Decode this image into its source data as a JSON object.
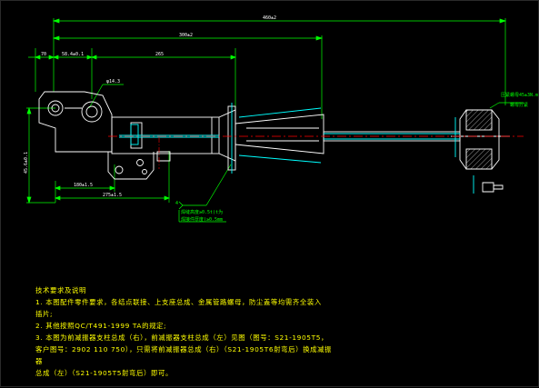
{
  "dimensions": {
    "overall_length": "460±2",
    "middle_length": "300±2",
    "top_offset_left": "70",
    "top_offset_mid": "58.4±0.1",
    "top_offset_right": "265",
    "diameter_label": "φ14.3",
    "height_label": "45.6±0.1",
    "bottom_dim_1": "180±1.5",
    "bottom_dim_2": "275±1.5"
  },
  "annotations": {
    "right_callout_line1": "压紧螺母45±3N.m",
    "right_callout_line2": "螺母拧紧",
    "weld_symbol": "4",
    "weld_note_1": "焊缝高度≥0.5t(t为",
    "weld_note_2": "焊接件厚度)≥0.5mm"
  },
  "notes": {
    "title": "技术要求及说明",
    "line1": "1. 本图配件零件要求，各结点联接、上支座总成、金属管路螺母，防尘盖等均需齐全装入",
    "line2": "插片;",
    "line3": "2. 其他按照QC/T491-1999 TA的规定;",
    "line4": "3. 本图为前减振器支柱总成（右），前减振器支柱总成（左）见图（图号：S21-1905T5，",
    "line5": "客户图号：2902 110 750），只需将前减振器总成（右）（S21-1905T6射弯后）换成减振器",
    "line6": "总成（左）（S21-1905T5射弯后）即可。"
  },
  "colors": {
    "background": "#000000",
    "outline": "#ffffff",
    "dimension": "#00ff00",
    "body": "#00ffff",
    "center_line": "#ff0000",
    "text": "#ffff00"
  }
}
